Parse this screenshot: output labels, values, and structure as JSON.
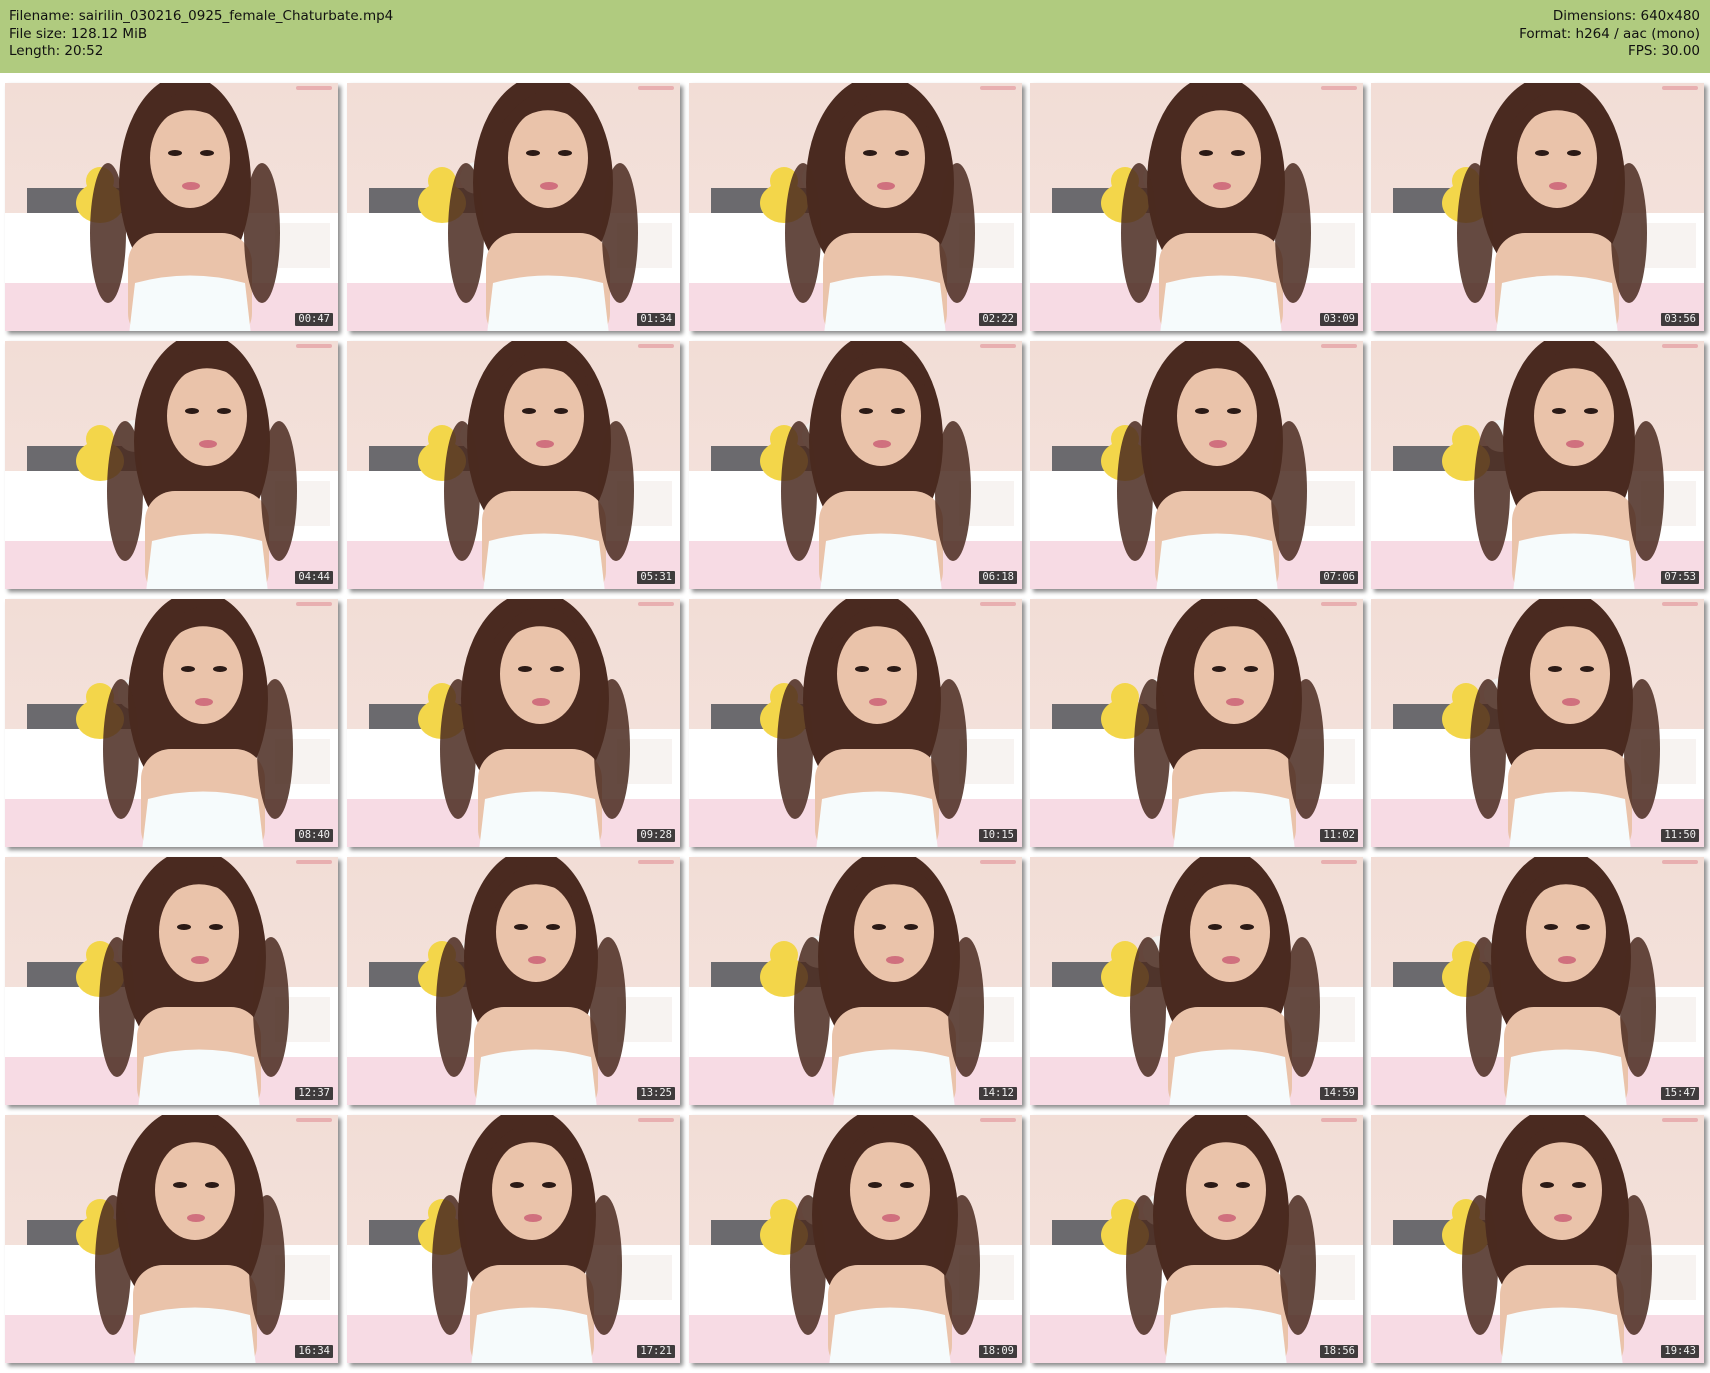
{
  "header": {
    "filename": "Filename: sairilin_030216_0925_female_Chaturbate.mp4",
    "filesize": "File size: 128.12 MiB",
    "length": "Length: 20:52",
    "dimensions": "Dimensions: 640x480",
    "format": "Format: h264 / aac (mono)",
    "fps": "FPS: 30.00"
  },
  "colors": {
    "header_bg": "#b0cb7f",
    "wall": "#f4e4de",
    "bed": "#ffffff",
    "blanket": "#f7dbe4",
    "headboard": "#6b6a6e",
    "teddy_yellow": "#f3d64a",
    "teddy_white": "#f2efec",
    "hair": "#4a2a20",
    "skin": "#eac3aa",
    "top": "#f6fbfc"
  },
  "thumbnails": [
    {
      "time": "00:47"
    },
    {
      "time": "01:34"
    },
    {
      "time": "02:22"
    },
    {
      "time": "03:09"
    },
    {
      "time": "03:56"
    },
    {
      "time": "04:44"
    },
    {
      "time": "05:31"
    },
    {
      "time": "06:18"
    },
    {
      "time": "07:06"
    },
    {
      "time": "07:53"
    },
    {
      "time": "08:40"
    },
    {
      "time": "09:28"
    },
    {
      "time": "10:15"
    },
    {
      "time": "11:02"
    },
    {
      "time": "11:50"
    },
    {
      "time": "12:37"
    },
    {
      "time": "13:25"
    },
    {
      "time": "14:12"
    },
    {
      "time": "14:59"
    },
    {
      "time": "15:47"
    },
    {
      "time": "16:34"
    },
    {
      "time": "17:21"
    },
    {
      "time": "18:09"
    },
    {
      "time": "18:56"
    },
    {
      "time": "19:43"
    }
  ]
}
